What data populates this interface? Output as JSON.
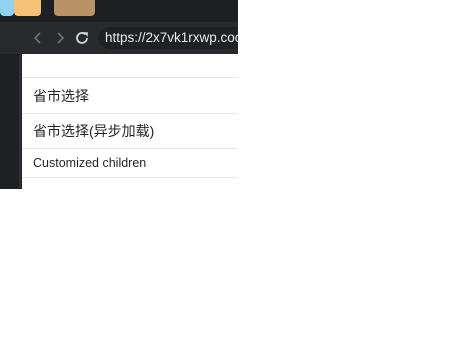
{
  "browser": {
    "url": "https://2x7vk1rxwp.coo",
    "icons": {
      "back": "chevron-left-icon",
      "forward": "chevron-right-icon",
      "reload": "reload-icon"
    },
    "colors": {
      "tab_strip": "#1e1f22",
      "toolbar": "#292a2d",
      "omnibox": "#202124"
    }
  },
  "menu": {
    "items": [
      {
        "label": "省市选择"
      },
      {
        "label": "省市选择(异步加载)"
      },
      {
        "label": "Customized children"
      }
    ]
  }
}
